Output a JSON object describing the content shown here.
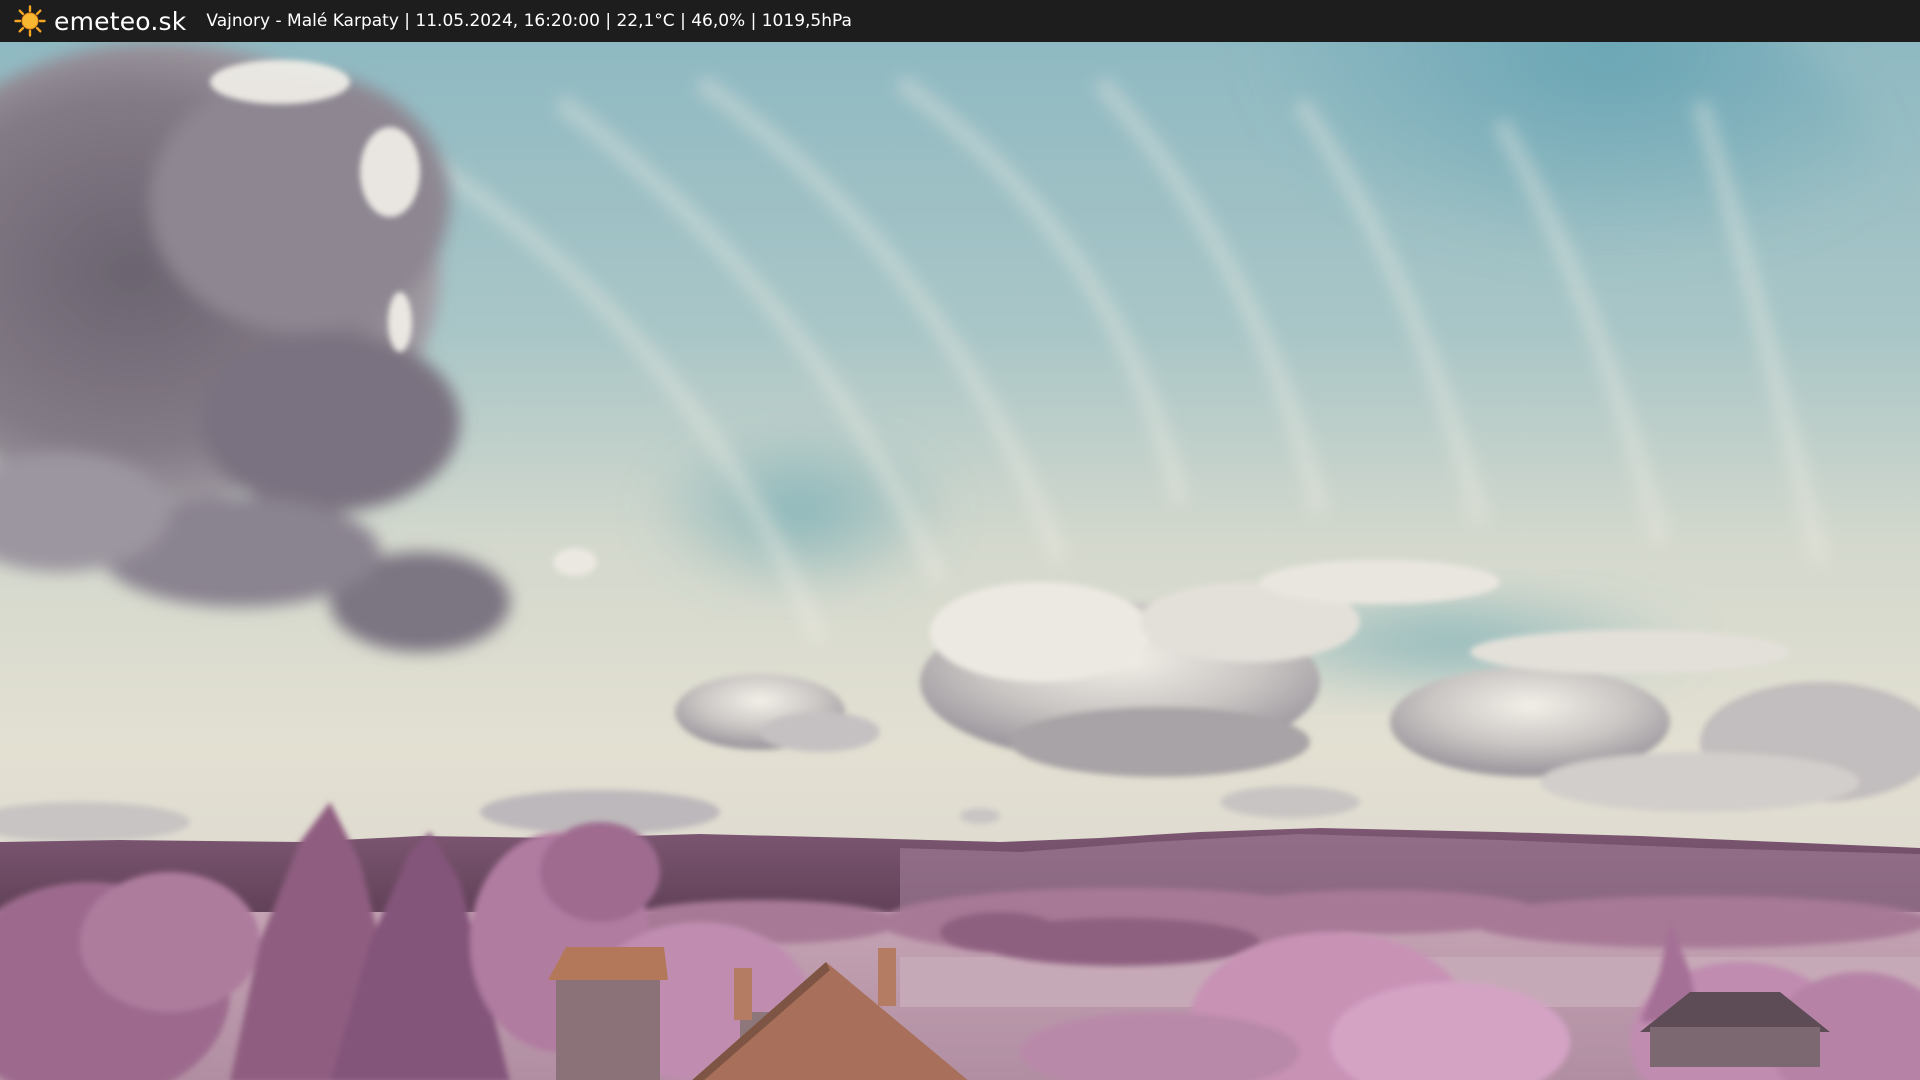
{
  "header": {
    "brand": "emeteo.sk",
    "brand_icon": "sun-icon",
    "caption": "Vajnory - Malé Karpaty | 11.05.2024, 16:20:00 | 22,1°C | 46,0% | 1019,5hPa"
  },
  "colors": {
    "bar_background": "#1d1d1d",
    "sun_color": "#f5a623",
    "sky_blue": "#7fb3bf",
    "sky_haze": "#dfe0d2",
    "vegetation_pink": "#b986a8",
    "hills_purple": "#6e4a63"
  }
}
